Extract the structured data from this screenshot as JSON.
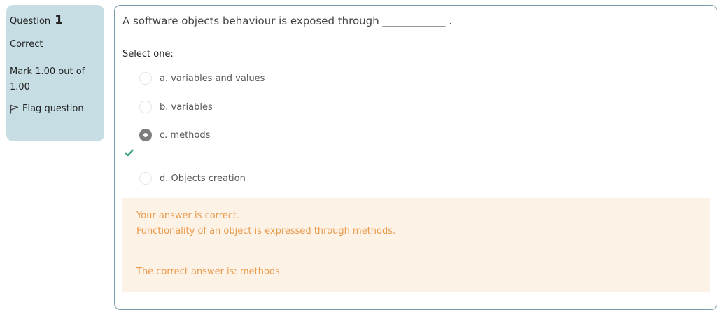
{
  "question_info": {
    "label": "Question",
    "number": "1",
    "state": "Correct",
    "grade": "Mark 1.00 out of 1.00",
    "flag_label": "Flag question"
  },
  "question": {
    "text": "A software objects behaviour is exposed through ____________ .",
    "prompt": "Select one:",
    "options": [
      {
        "label": "a. variables and values",
        "selected": false
      },
      {
        "label": "b. variables",
        "selected": false
      },
      {
        "label": "c. methods",
        "selected": true
      },
      {
        "label": "d. Objects creation",
        "selected": false
      }
    ]
  },
  "feedback": {
    "result": "Your answer is correct.",
    "general": "Functionality of an object is expressed through methods.",
    "right_answer": "The correct answer is: methods"
  },
  "colors": {
    "info_bg": "#c5dde3",
    "feedback_bg": "#fdf2e6",
    "feedback_text": "#e99a4c",
    "correct_check": "#3fa67d"
  }
}
